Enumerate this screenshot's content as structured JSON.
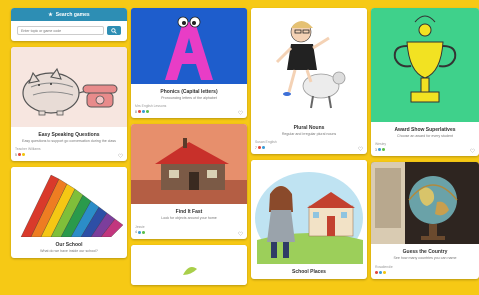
{
  "search": {
    "title": "Search games",
    "placeholder": "Enter topic or game code",
    "icon": "search-icon"
  },
  "cards": {
    "speaking": {
      "title": "Easy Speaking Questions",
      "desc": "Easy questions to support go conversation during the class",
      "author": "Teacher Williams",
      "count": "5"
    },
    "school": {
      "title": "Our School",
      "desc": "What do we have inside our school?"
    },
    "phonics": {
      "title": "Phonics (Capital letters)",
      "desc": "Pronouncing letters of the alphabet",
      "author": "Mrs English Lessons",
      "count": "8",
      "letter": "A"
    },
    "findit": {
      "title": "Find It Fast",
      "desc": "Look for objects around your home",
      "author": "Jessie",
      "count": "4"
    },
    "plural": {
      "title": "Plural Nouns",
      "desc": "Regular and irregular plural nouns",
      "author": "Susan English",
      "count": "7"
    },
    "award": {
      "title": "Award Show Superlatives",
      "desc": "Choose an award for every student",
      "author": "Wesley",
      "count": "3"
    },
    "country": {
      "title": "Guess the Country",
      "desc": "See how many countries you can name",
      "author": "Rosaliendie"
    },
    "schoolday": {
      "title": "School Places"
    }
  },
  "colors": {
    "background": "#f6c915",
    "accent": "#2d8eb4",
    "tag_red": "#e2443b",
    "tag_blue": "#3a9bd6",
    "tag_yellow": "#f2c40f",
    "tag_green": "#5bbf4a"
  }
}
